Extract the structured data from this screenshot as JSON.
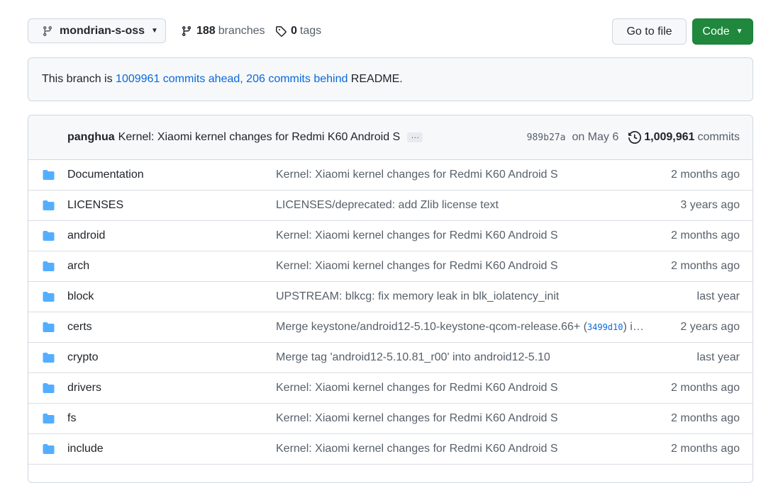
{
  "topbar": {
    "branch_name": "mondrian-s-oss",
    "branches_count": "188",
    "branches_label": "branches",
    "tags_count": "0",
    "tags_label": "tags",
    "goto_file": "Go to file",
    "code": "Code"
  },
  "branch_info": {
    "prefix": "This branch is ",
    "ahead": "1009961 commits ahead,",
    "behind": "206 commits behind",
    "suffix": " README."
  },
  "latest_commit": {
    "author": "panghua",
    "message": "Kernel: Xiaomi kernel changes for Redmi K60 Android S",
    "ellipsis": "…",
    "sha": "989b27a",
    "date": "on May 6",
    "commits_count": "1,009,961",
    "commits_label": "commits"
  },
  "files": [
    {
      "name": "Documentation",
      "message": "Kernel: Xiaomi kernel changes for Redmi K60 Android S",
      "age": "2 months ago"
    },
    {
      "name": "LICENSES",
      "message": "LICENSES/deprecated: add Zlib license text",
      "age": "3 years ago"
    },
    {
      "name": "android",
      "message": "Kernel: Xiaomi kernel changes for Redmi K60 Android S",
      "age": "2 months ago"
    },
    {
      "name": "arch",
      "message": "Kernel: Xiaomi kernel changes for Redmi K60 Android S",
      "age": "2 months ago"
    },
    {
      "name": "block",
      "message": "UPSTREAM: blkcg: fix memory leak in blk_iolatency_init",
      "age": "last year"
    },
    {
      "name": "certs",
      "message": "Merge keystone/android12-5.10-keystone-qcom-release.66+ (",
      "message_hash": "3499d10",
      "message_tail": ") i…",
      "age": "2 years ago"
    },
    {
      "name": "crypto",
      "message": "Merge tag 'android12-5.10.81_r00' into android12-5.10",
      "age": "last year"
    },
    {
      "name": "drivers",
      "message": "Kernel: Xiaomi kernel changes for Redmi K60 Android S",
      "age": "2 months ago"
    },
    {
      "name": "fs",
      "message": "Kernel: Xiaomi kernel changes for Redmi K60 Android S",
      "age": "2 months ago"
    },
    {
      "name": "include",
      "message": "Kernel: Xiaomi kernel changes for Redmi K60 Android S",
      "age": "2 months ago"
    }
  ],
  "icons": {
    "branch": "git-branch-icon",
    "tag": "tag-icon",
    "history": "history-icon",
    "folder": "folder-icon"
  },
  "colors": {
    "link": "#0969da",
    "folder": "#54aeff",
    "code_button": "#1f883d"
  }
}
